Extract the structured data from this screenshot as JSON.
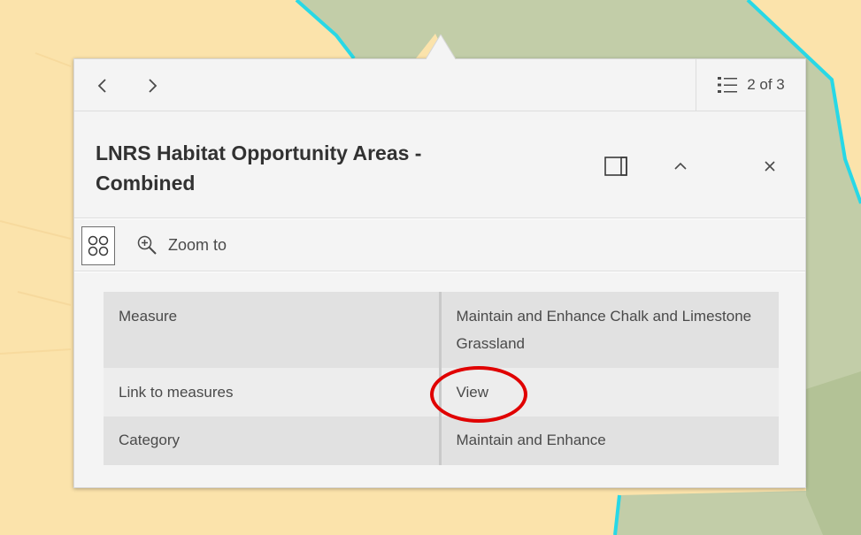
{
  "map": {
    "background_color": "#fbe3ab",
    "polygon_color": "#c2cda8",
    "outline_color": "#28d8e6"
  },
  "popup": {
    "navigation": {
      "previous_icon": "chevron-left-icon",
      "next_icon": "chevron-right-icon",
      "feature_list_icon": "list-icon",
      "feature_count": "2 of 3"
    },
    "title": "LNRS Habitat Opportunity Areas - Combined",
    "header_actions": {
      "dock_icon": "dock-icon",
      "collapse_icon": "chevron-up-icon",
      "close_icon": "close-icon"
    },
    "actions": {
      "menu_icon": "action-grid-icon",
      "zoom_icon": "zoom-in-icon",
      "zoom_label": "Zoom to"
    },
    "fields": [
      {
        "key": "Measure",
        "value": "Maintain and Enhance Chalk and Limestone Grassland"
      },
      {
        "key": "Link to measures",
        "value": "View"
      },
      {
        "key": "Category",
        "value": "Maintain and Enhance"
      }
    ]
  },
  "annotation": {
    "ring_color": "#e00000"
  }
}
